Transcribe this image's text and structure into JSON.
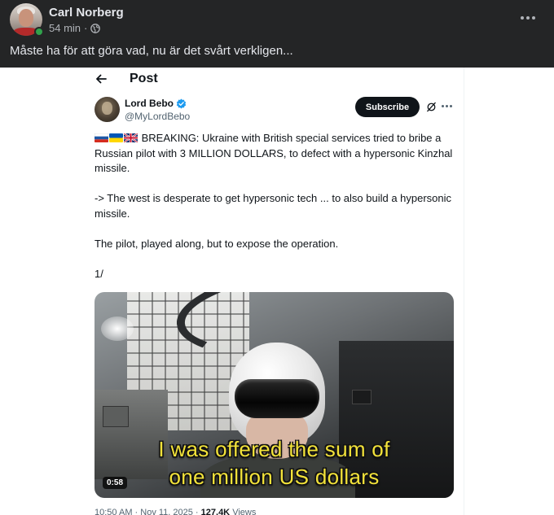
{
  "post": {
    "author": "Carl Norberg",
    "time": "54 min",
    "separator": "·",
    "caption": "Måste ha för att göra vad, nu är det svårt verkligen..."
  },
  "screenshot": {
    "page_title": "Post",
    "author_name": "Lord Bebo",
    "author_handle": "@MyLordBebo",
    "subscribe_label": "Subscribe",
    "tweet": {
      "flags": [
        "russia-flag",
        "ukraine-flag",
        "uk-flag"
      ],
      "paragraph1": "BREAKING: Ukraine with British special services tried to bribe a Russian pilot with 3 MILLION DOLLARS, to defect with a hypersonic Kinzhal missile.",
      "paragraph2": "-> The west is desperate to get hypersonic tech ... to also build a hypersonic missile.",
      "paragraph3": "The pilot, played along, but to expose the operation.",
      "paragraph4": "1/"
    },
    "video": {
      "caption_line1": "I was offered the sum of",
      "caption_line2": "one million US dollars",
      "duration": "0:58"
    },
    "footer": {
      "timestamp": "10:50 AM · Nov 11, 2025 ·",
      "views_count": "127.4K",
      "views_label": "Views"
    }
  },
  "colors": {
    "fb_bg": "#242526",
    "fb_text": "#e4e6eb",
    "fb_secondary": "#b0b3b8",
    "online": "#31a24c",
    "x_text": "#0f1419",
    "x_secondary": "#536471",
    "verified": "#1d9bf0",
    "caption_yellow": "#f2e23a"
  }
}
